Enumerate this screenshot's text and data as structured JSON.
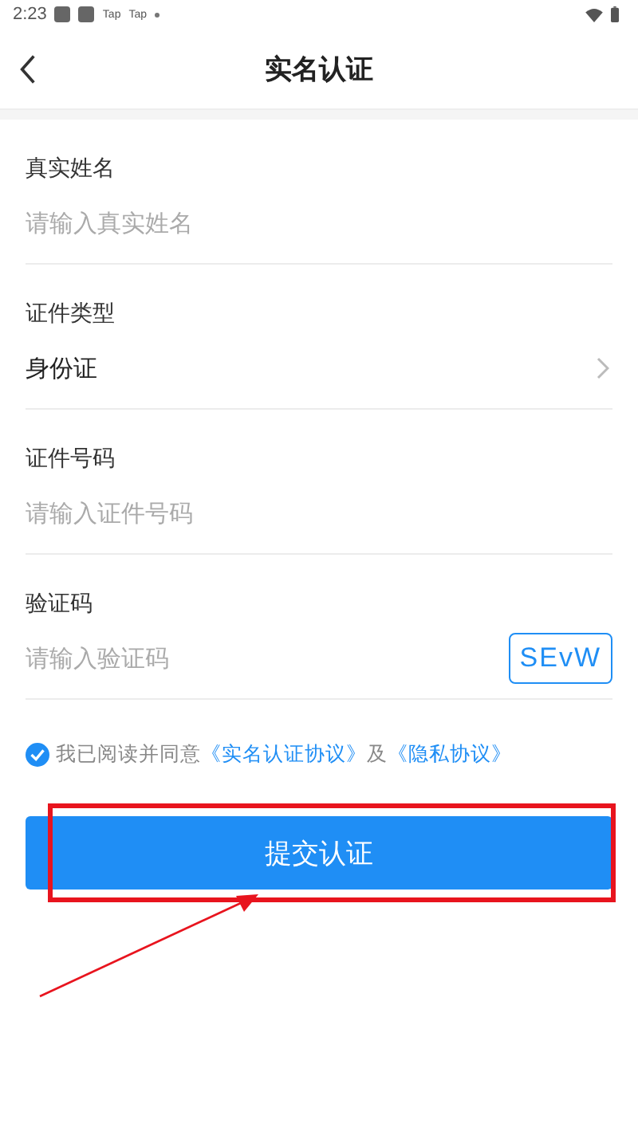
{
  "status_bar": {
    "time": "2:23",
    "notifications": [
      "Tap",
      "Tap"
    ]
  },
  "header": {
    "title": "实名认证"
  },
  "fields": [
    {
      "kind": "input",
      "label": "真实姓名",
      "placeholder": "请输入真实姓名"
    },
    {
      "kind": "select",
      "label": "证件类型",
      "value": "身份证"
    },
    {
      "kind": "input",
      "label": "证件号码",
      "placeholder": "请输入证件号码"
    },
    {
      "kind": "captcha",
      "label": "验证码",
      "placeholder": "请输入验证码",
      "captcha": "SEvW"
    }
  ],
  "agreement": {
    "checked": true,
    "text": "我已阅读并同意",
    "link1": "《实名认证协议》",
    "joiner": "及",
    "link2": "《隐私协议》"
  },
  "submit_button": {
    "label": "提交认证"
  },
  "annotation": {
    "highlight": true,
    "arrow": true
  }
}
